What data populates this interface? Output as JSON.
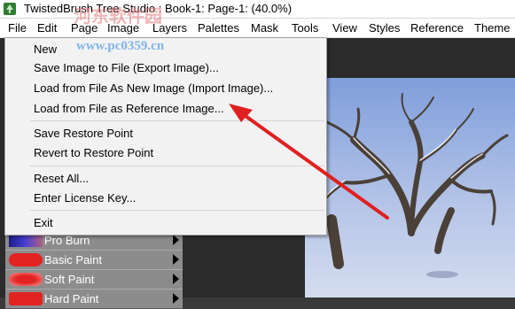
{
  "window": {
    "title": "TwistedBrush Tree Studio : Book-1: Page-1:  (40.0%)"
  },
  "menubar": {
    "items": [
      "File",
      "Edit",
      "Page",
      "Image",
      "Layers",
      "Palettes",
      "Mask",
      "Tools",
      "View",
      "Styles",
      "Reference",
      "Theme"
    ]
  },
  "file_menu": {
    "items": [
      {
        "label": "New"
      },
      {
        "label": "Save Image to File (Export Image)..."
      },
      {
        "label": "Load from File As New Image (Import Image)..."
      },
      {
        "label": "Load from File as Reference Image..."
      },
      {
        "label": "Save Restore Point"
      },
      {
        "label": "Revert to Restore Point"
      },
      {
        "label": "Reset All..."
      },
      {
        "label": "Enter License Key..."
      },
      {
        "label": "Exit"
      }
    ]
  },
  "brush_panel": {
    "items": [
      {
        "label": "Pro Burn",
        "color": "#4a3fd0"
      },
      {
        "label": "Basic Paint",
        "color": "#e32222"
      },
      {
        "label": "Soft Paint",
        "color": "#e32222"
      },
      {
        "label": "Hard Paint",
        "color": "#e32222"
      }
    ]
  },
  "watermark": {
    "text": "河东软件园",
    "url": "www.pc0359.cn"
  },
  "colors": {
    "annotation_arrow": "#e02020",
    "canvas_sky_top": "#8aa7df",
    "canvas_sky_bottom": "#c8d4ee"
  }
}
